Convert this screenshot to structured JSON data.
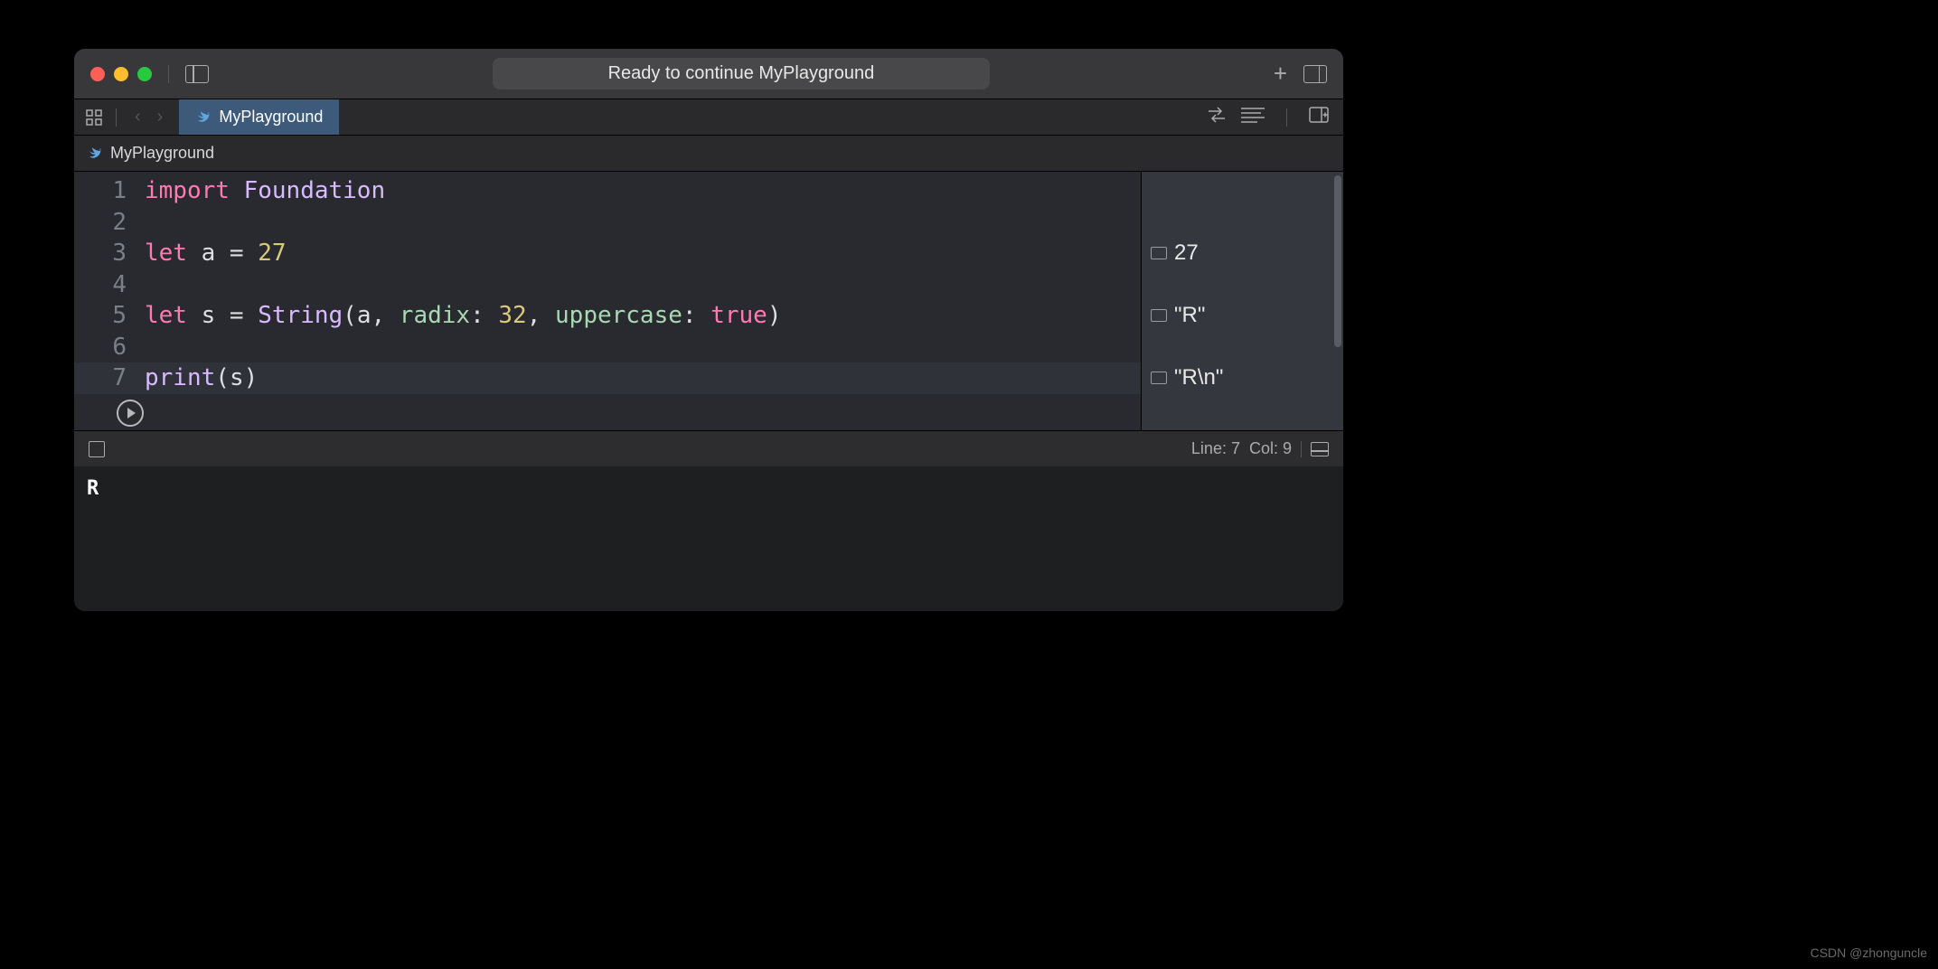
{
  "titlebar": {
    "status": "Ready to continue MyPlayground"
  },
  "tab": {
    "name": "MyPlayground"
  },
  "breadcrumb": {
    "name": "MyPlayground"
  },
  "code": {
    "lines": [
      {
        "num": "1",
        "tokens": [
          [
            "kw",
            "import"
          ],
          [
            "punct",
            " "
          ],
          [
            "type",
            "Foundation"
          ]
        ]
      },
      {
        "num": "2",
        "tokens": []
      },
      {
        "num": "3",
        "tokens": [
          [
            "kw",
            "let"
          ],
          [
            "punct",
            " "
          ],
          [
            "ident",
            "a"
          ],
          [
            "punct",
            " = "
          ],
          [
            "num",
            "27"
          ]
        ]
      },
      {
        "num": "4",
        "tokens": []
      },
      {
        "num": "5",
        "tokens": [
          [
            "kw",
            "let"
          ],
          [
            "punct",
            " "
          ],
          [
            "ident",
            "s"
          ],
          [
            "punct",
            " = "
          ],
          [
            "type",
            "String"
          ],
          [
            "punct",
            "("
          ],
          [
            "ident",
            "a"
          ],
          [
            "punct",
            ", "
          ],
          [
            "arg",
            "radix"
          ],
          [
            "punct",
            ": "
          ],
          [
            "num",
            "32"
          ],
          [
            "punct",
            ", "
          ],
          [
            "arg",
            "uppercase"
          ],
          [
            "punct",
            ": "
          ],
          [
            "bool",
            "true"
          ],
          [
            "punct",
            ")"
          ]
        ]
      },
      {
        "num": "6",
        "tokens": []
      },
      {
        "num": "7",
        "tokens": [
          [
            "type",
            "print"
          ],
          [
            "punct",
            "("
          ],
          [
            "ident",
            "s"
          ],
          [
            "punct",
            ")"
          ]
        ],
        "highlighted": true
      }
    ]
  },
  "results": [
    {
      "line": 3,
      "value": "27"
    },
    {
      "line": 5,
      "value": "\"R\""
    },
    {
      "line": 7,
      "value": "\"R\\n\""
    }
  ],
  "debug": {
    "line_label": "Line: 7",
    "col_label": "Col: 9"
  },
  "console": {
    "output": "R"
  },
  "watermark": "CSDN @zhonguncle"
}
